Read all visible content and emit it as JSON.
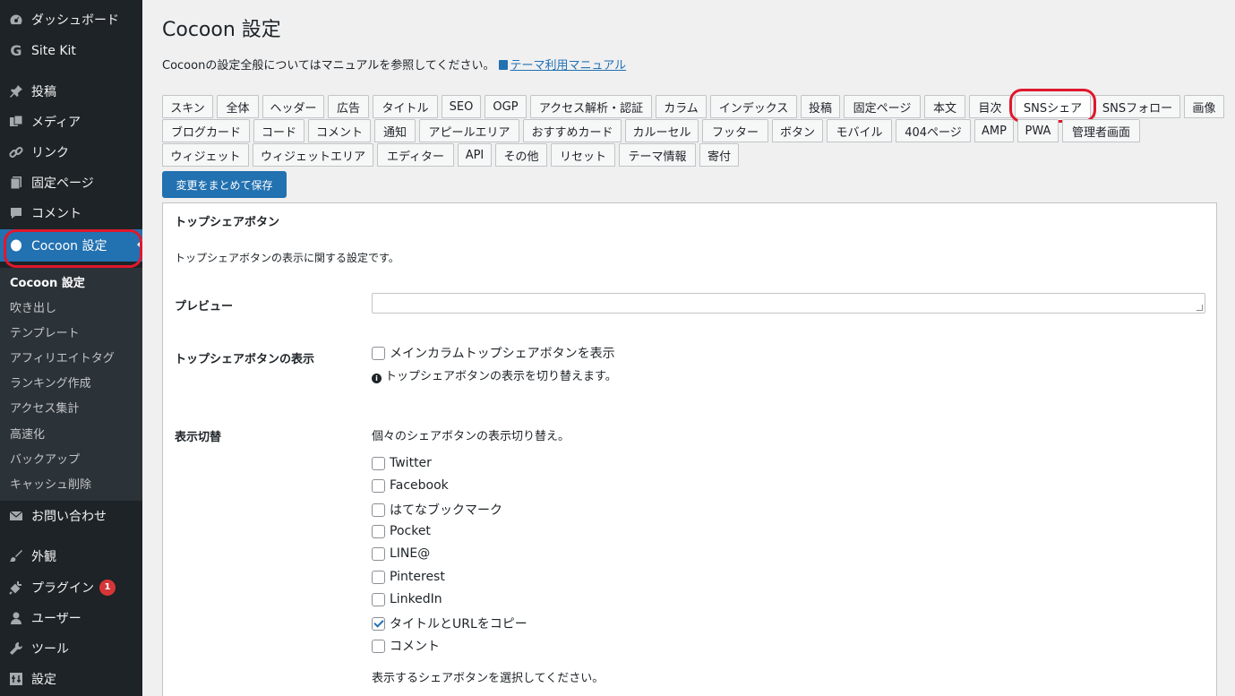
{
  "sidebar": {
    "items": [
      {
        "name": "dashboard",
        "label": "ダッシュボード",
        "icon": "dashboard-icon"
      },
      {
        "name": "site-kit",
        "label": "Site Kit",
        "icon": "google-g-icon"
      },
      {
        "name": "posts",
        "label": "投稿",
        "icon": "pin-icon"
      },
      {
        "name": "media",
        "label": "メディア",
        "icon": "media-icon"
      },
      {
        "name": "links",
        "label": "リンク",
        "icon": "link-icon"
      },
      {
        "name": "pages",
        "label": "固定ページ",
        "icon": "page-icon"
      },
      {
        "name": "comments",
        "label": "コメント",
        "icon": "comment-bubble-icon"
      },
      {
        "name": "cocoon-settings",
        "label": "Cocoon 設定",
        "icon": "cocoon-icon"
      },
      {
        "name": "contact",
        "label": "お問い合わせ",
        "icon": "mail-icon"
      },
      {
        "name": "appearance",
        "label": "外観",
        "icon": "brush-icon"
      },
      {
        "name": "plugins",
        "label": "プラグイン",
        "icon": "plug-icon",
        "badge": "1"
      },
      {
        "name": "users",
        "label": "ユーザー",
        "icon": "user-icon"
      },
      {
        "name": "tools",
        "label": "ツール",
        "icon": "wrench-icon"
      },
      {
        "name": "settings",
        "label": "設定",
        "icon": "settings-icon"
      }
    ],
    "submenu": [
      "Cocoon 設定",
      "吹き出し",
      "テンプレート",
      "アフィリエイトタグ",
      "ランキング作成",
      "アクセス集計",
      "高速化",
      "バックアップ",
      "キャッシュ削除"
    ]
  },
  "main": {
    "title": "Cocoon 設定",
    "intro_text": "Cocoonの設定全般についてはマニュアルを参照してください。",
    "manual_link": "テーマ利用マニュアル",
    "tabs_row1": [
      "スキン",
      "全体",
      "ヘッダー",
      "広告",
      "タイトル",
      "SEO",
      "OGP",
      "アクセス解析・認証",
      "カラム",
      "インデックス",
      "投稿",
      "固定ページ",
      "本文",
      "目次",
      "SNSシェア",
      "SNSフォロー",
      "画像"
    ],
    "tabs_row2": [
      "ブログカード",
      "コード",
      "コメント",
      "通知",
      "アピールエリア",
      "おすすめカード",
      "カルーセル",
      "フッター",
      "ボタン",
      "モバイル",
      "404ページ",
      "AMP",
      "PWA",
      "管理者画面"
    ],
    "tabs_row3": [
      "ウィジェット",
      "ウィジェットエリア",
      "エディター",
      "API",
      "その他",
      "リセット",
      "テーマ情報",
      "寄付"
    ],
    "active_tab": "SNSシェア",
    "save_button": "変更をまとめて保存"
  },
  "panel": {
    "heading": "トップシェアボタン",
    "description": "トップシェアボタンの表示に関する設定です。",
    "preview_label": "プレビュー",
    "display_label": "トップシェアボタンの表示",
    "display_checkbox": {
      "label": "メインカラムトップシェアボタンを表示",
      "checked": false
    },
    "display_help": "トップシェアボタンの表示を切り替えます。",
    "toggle_label": "表示切替",
    "toggle_desc": "個々のシェアボタンの表示切り替え。",
    "share_buttons": [
      {
        "label": "Twitter",
        "checked": false
      },
      {
        "label": "Facebook",
        "checked": false
      },
      {
        "label": "はてなブックマーク",
        "checked": false
      },
      {
        "label": "Pocket",
        "checked": false
      },
      {
        "label": "LINE@",
        "checked": false
      },
      {
        "label": "Pinterest",
        "checked": false
      },
      {
        "label": "LinkedIn",
        "checked": false
      },
      {
        "label": "タイトルとURLをコピー",
        "checked": true
      },
      {
        "label": "コメント",
        "checked": false
      }
    ],
    "select_help": "表示するシェアボタンを選択してください。"
  }
}
